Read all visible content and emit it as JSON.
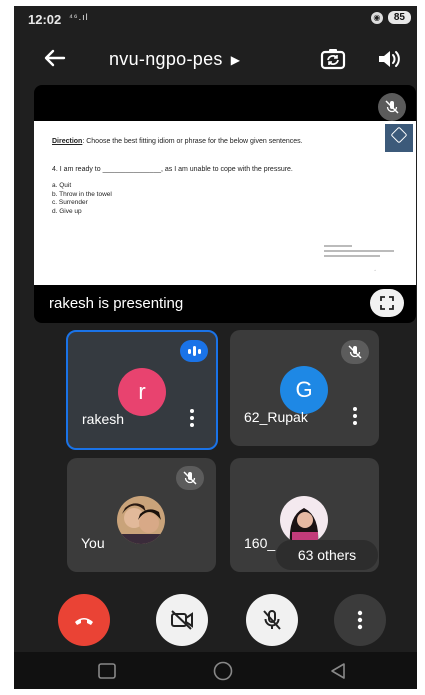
{
  "status_bar": {
    "time": "12:02",
    "signal": "⁴⁶.ıl",
    "battery": "85"
  },
  "header": {
    "meeting_code": "nvu-ngpo-pes"
  },
  "presentation": {
    "caption": "rakesh is presenting",
    "slide": {
      "direction_label": "Direction",
      "direction_text": ": Choose the best fitting idiom or phrase for the below given sentences.",
      "question": "4. I am ready to _______________, as I am unable to cope with the pressure.",
      "options": [
        "a. Quit",
        "b. Throw in the towel",
        "c. Surrender",
        "d. Give up"
      ]
    }
  },
  "participants": [
    {
      "name": "rakesh",
      "initial": "r",
      "avatar_color": "#e8436f",
      "state": "speaking",
      "active": true
    },
    {
      "name": "62_Rupak",
      "initial": "G",
      "avatar_color": "#1e88e5",
      "state": "muted"
    },
    {
      "name": "You",
      "state": "muted",
      "avatar": "photo"
    },
    {
      "name": "160_",
      "avatar": "photo"
    }
  ],
  "others_chip": "63 others",
  "controls": {
    "end_call_color": "#ea4335",
    "items": [
      "end-call-icon",
      "camera-off-icon",
      "mic-off-icon",
      "more-options-icon"
    ]
  },
  "colors": {
    "background": "#1f1f1f",
    "tile": "#3b3b3b",
    "accent": "#1a73e8",
    "active_border": "#1a73e8"
  }
}
